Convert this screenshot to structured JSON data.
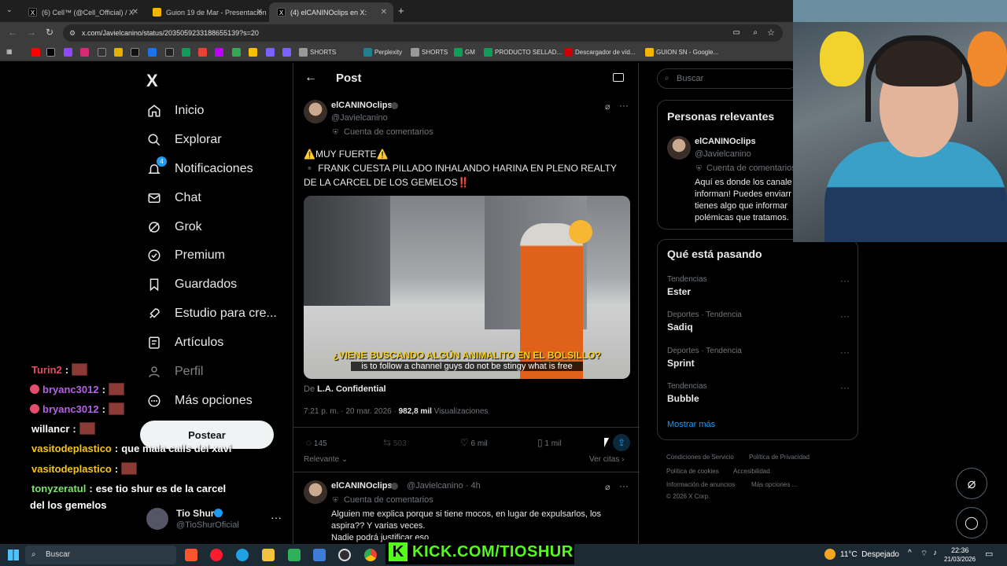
{
  "browser": {
    "tabs": [
      {
        "label": "(6) Cell™ (@Cell_Official) / X",
        "icon": "x-icon"
      },
      {
        "label": "Guion 19 de Mar - Presentación",
        "icon": "slides-icon"
      },
      {
        "label": "(4) elCANINOclips en X:",
        "icon": "x-icon"
      }
    ],
    "url": "x.com/Javielcanino/status/2035059233188655139?s=20",
    "bookmarks": [
      "SHORTS",
      "Perplexity",
      "SHORTS",
      "GM",
      "PRODUCTO SELLAD...",
      "Descargador de víd...",
      "GUION SN - Google..."
    ]
  },
  "nav": {
    "logo": "X",
    "items": [
      {
        "label": "Inicio",
        "icon": "home-icon"
      },
      {
        "label": "Explorar",
        "icon": "search-icon"
      },
      {
        "label": "Notificaciones",
        "icon": "bell-icon",
        "badge": "4"
      },
      {
        "label": "Chat",
        "icon": "mail-icon"
      },
      {
        "label": "Grok",
        "icon": "grok-icon"
      },
      {
        "label": "Premium",
        "icon": "premium-icon"
      },
      {
        "label": "Guardados",
        "icon": "bookmark-icon"
      },
      {
        "label": "Estudio para cre...",
        "icon": "rocket-icon"
      },
      {
        "label": "Artículos",
        "icon": "article-icon"
      },
      {
        "label": "Perfil",
        "icon": "person-icon"
      },
      {
        "label": "Más opciones",
        "icon": "more-circle-icon"
      }
    ],
    "post_button": "Postear",
    "profile": {
      "name": "Tio Shur",
      "handle": "@TioShurOficial"
    }
  },
  "chat": [
    {
      "user": "Turin2",
      "msg": "",
      "user_color": "#e84a5f",
      "emote": true
    },
    {
      "user": "bryanc3012",
      "msg": "",
      "user_color": "#b660e8",
      "emote": true,
      "badge": true
    },
    {
      "user": "bryanc3012",
      "msg": "",
      "user_color": "#b660e8",
      "emote": true,
      "badge": true
    },
    {
      "user": "willancr",
      "msg": "",
      "user_color": "#ffffff",
      "emote": true
    },
    {
      "user": "vasitodeplastico",
      "msg": "que mala calls del xavi",
      "user_color": "#f5c518",
      "emote": false
    },
    {
      "user": "vasitodeplastico",
      "msg": "",
      "user_color": "#f5c518",
      "emote": true
    },
    {
      "user": "tonyzeratul",
      "msg": "ese tio shur es de la carcel",
      "user_color": "#7ee36b",
      "emote": false
    },
    {
      "user": "",
      "msg": "del los gemelos",
      "user_color": "#ffffff",
      "emote": false
    }
  ],
  "post_header": {
    "back": "←",
    "title": "Post"
  },
  "post": {
    "author": "elCANINOclips",
    "handle": "@Javielcanino",
    "label": "Cuenta de comentarios",
    "text_line1": "⚠️MUY FUERTE⚠️",
    "text_line2": "▪️ FRANK CUESTA PILLADO INHALANDO HARINA EN PLENO REALTY DE LA CARCEL DE LOS GEMELOS‼️",
    "video_caption_top": "¿VIENE BUSCANDO ALGÚN ANIMALITO EN EL BOLSILLO?",
    "video_caption_bottom": "is to follow a channel guys do not be stingy what is free",
    "source_prefix": "De",
    "source": "L.A. Confidential",
    "time": "7:21 p. m. · 20 mar. 2026 ·",
    "views": "982,8 mil",
    "views_label": "Visualizaciones",
    "replies": "145",
    "reposts": "503",
    "likes": "6 mil",
    "bookmarks": "1 mil",
    "sort": "Relevante",
    "quotes": "Ver citas"
  },
  "reply": {
    "author": "elCANINOclips",
    "handle": "@Javielcanino · 4h",
    "label": "Cuenta de comentarios",
    "text1": "Alguien me explica porque si tiene mocos, en lugar de expulsarlos, los aspira?? Y varias veces.",
    "text2": "Nadie podrá justificar eso"
  },
  "right": {
    "search_placeholder": "Buscar",
    "relevant_title": "Personas relevantes",
    "relevant": {
      "name": "elCANINOclips",
      "handle": "@Javielcanino",
      "label": "Cuenta de comentarios",
      "bio": "Aquí es donde los canale informan! Puedes enviarr tienes algo que informar polémicas que tratamos."
    },
    "trends_title": "Qué está pasando",
    "trends": [
      {
        "category": "Tendencias",
        "name": "Ester"
      },
      {
        "category": "Deportes · Tendencia",
        "name": "Sadiq"
      },
      {
        "category": "Deportes · Tendencia",
        "name": "Sprint"
      },
      {
        "category": "Tendencias",
        "name": "Bubble"
      }
    ],
    "show_more": "Mostrar más",
    "footer": [
      "Condiciones de Servicio",
      "Política de Privacidad",
      "Política de cookies",
      "Accesibilidad",
      "Información de anuncios",
      "Más opciones ...",
      "© 2026 X Corp."
    ]
  },
  "overlay": {
    "kick": "KICK.COM/TIOSHUR",
    "kick_logo": "K"
  },
  "taskbar": {
    "search": "Buscar",
    "weather": "11°C  Despejado",
    "time": "22:36",
    "date": "21/03/2026"
  },
  "colors": {
    "accent": "#1d9bf0",
    "kick": "#53fc18",
    "bg": "#000000"
  }
}
